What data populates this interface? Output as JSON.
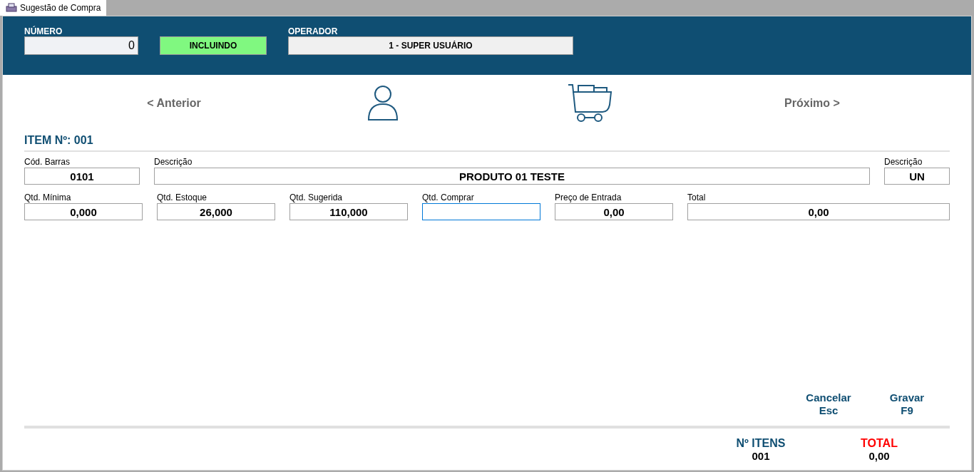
{
  "tab": {
    "label": "Sugestão de Compra",
    "selected": true
  },
  "header": {
    "numero": {
      "label": "NÚMERO",
      "value": "0"
    },
    "status": "INCLUINDO",
    "operador": {
      "label": "OPERADOR",
      "value": "1 - SUPER USUÁRIO"
    }
  },
  "nav": {
    "previous": "< Anterior",
    "next": "Próximo >"
  },
  "item_title": "ITEM Nº: 001",
  "row1": [
    {
      "label": "Cód. Barras",
      "value": "0101",
      "focused": false
    },
    {
      "label": "Descrição",
      "value": "PRODUTO 01 TESTE",
      "focused": false
    },
    {
      "label": "Descrição",
      "value": "UN",
      "focused": false
    }
  ],
  "row2": [
    {
      "label": "Qtd. Mínima",
      "value": "0,000",
      "focused": false
    },
    {
      "label": "Qtd. Estoque",
      "value": "26,000",
      "focused": false
    },
    {
      "label": "Qtd. Sugerida",
      "value": "110,000",
      "focused": false
    },
    {
      "label": "Qtd. Comprar",
      "focused": true
    },
    {
      "label": "Preço de Entrada",
      "value": "0,00",
      "focused": false
    },
    {
      "label": "Total",
      "value": "0,00",
      "focused": false
    }
  ],
  "actions": [
    {
      "label": "Cancelar",
      "key": "Esc"
    },
    {
      "label": "Gravar",
      "key": "F9"
    }
  ],
  "summary": [
    {
      "label": "Nº ITENS",
      "value": "001",
      "kind": "count"
    },
    {
      "label": "TOTAL",
      "value": "0,00",
      "kind": "total"
    }
  ]
}
